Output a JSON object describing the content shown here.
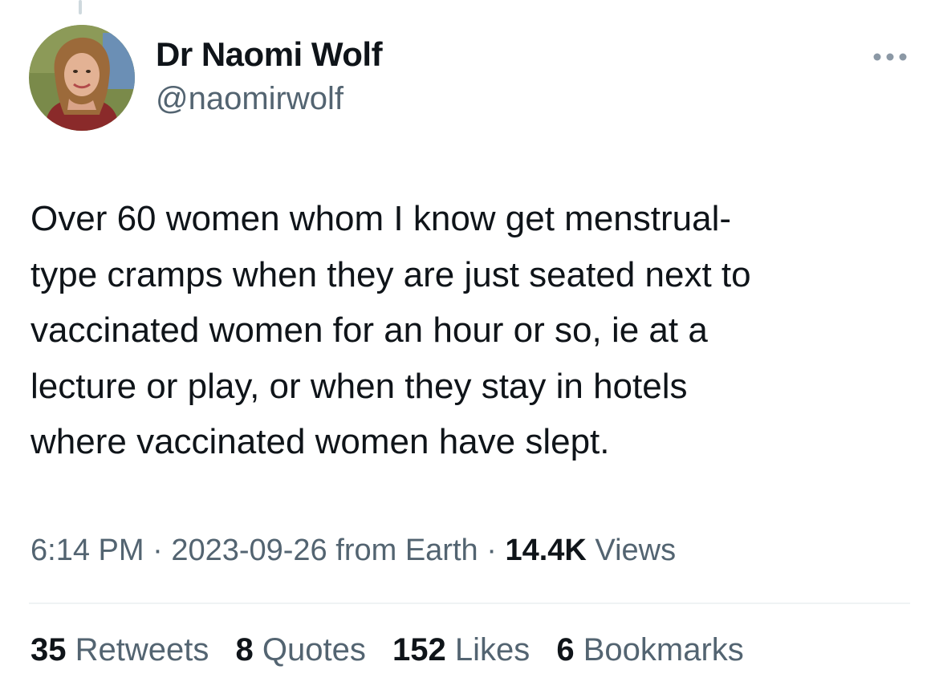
{
  "author": {
    "display_name": "Dr Naomi Wolf",
    "handle": "@naomirwolf"
  },
  "tweet": {
    "text_lines": [
      "Over 60 women whom I know get menstrual-",
      "type cramps when they are just seated next to",
      "vaccinated women for an hour or so, ie at a",
      "lecture or play, or when they stay in hotels",
      "where vaccinated women have slept."
    ]
  },
  "meta": {
    "time": "6:14 PM",
    "separator": "·",
    "date": "2023-09-26",
    "source": "from Earth",
    "views_count": "14.4K",
    "views_label": "Views"
  },
  "stats": [
    {
      "count": "35",
      "label": "Retweets"
    },
    {
      "count": "8",
      "label": "Quotes"
    },
    {
      "count": "152",
      "label": "Likes"
    },
    {
      "count": "6",
      "label": "Bookmarks"
    }
  ],
  "icons": {
    "more": "more-horizontal-icon"
  },
  "colors": {
    "text_primary": "#0f1419",
    "text_secondary": "#536471",
    "divider": "#eff3f4",
    "thread_line": "#cfd9de"
  }
}
